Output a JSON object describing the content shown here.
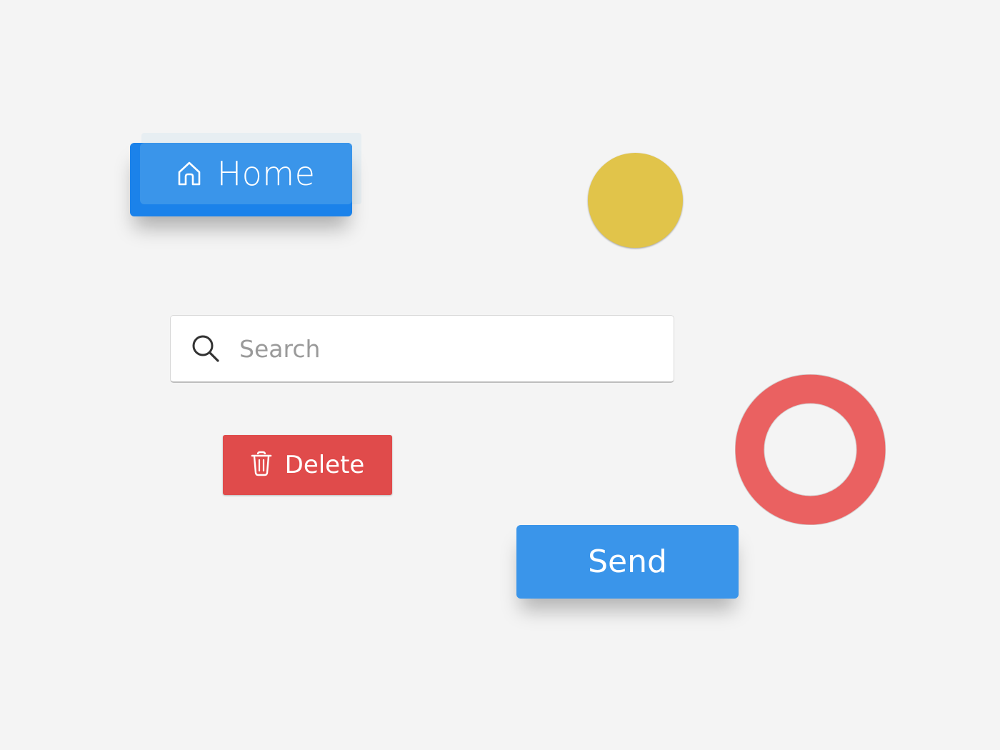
{
  "buttons": {
    "home": {
      "label": "Home",
      "icon": "home-icon",
      "color": "#3a95ea"
    },
    "delete": {
      "label": "Delete",
      "icon": "trash-icon",
      "color": "#e04b4b"
    },
    "send": {
      "label": "Send",
      "color": "#3a95ea"
    }
  },
  "search": {
    "placeholder": "Search",
    "value": "",
    "icon": "search-icon"
  },
  "decorations": {
    "yellow_circle_color": "#e1c44a",
    "red_ring_color": "#ea6161"
  }
}
